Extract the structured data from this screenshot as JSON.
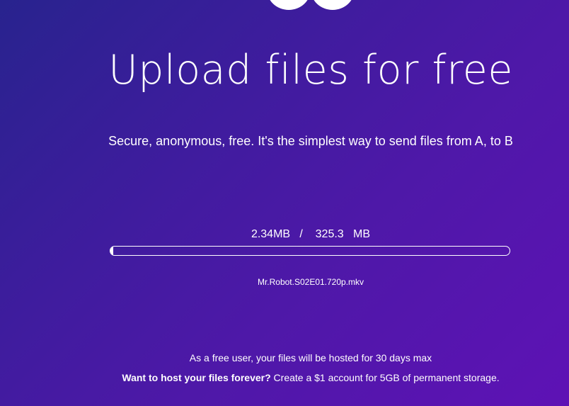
{
  "colors": {
    "background_start": "#28238e",
    "background_end": "#5e12b5",
    "text": "#ffffff"
  },
  "logo": {
    "icon": "logo-icon"
  },
  "hero": {
    "title": "Upload files for free",
    "subtitle": "Secure, anonymous, free. It's the simplest way to send files from A, to B"
  },
  "upload": {
    "uploaded": "2.34MB",
    "separator": "/",
    "total_value": "325.3",
    "total_unit": "MB",
    "progress": 0.0072,
    "filename": "Mr.Robot.S02E01.720p.mkv"
  },
  "footer": {
    "note": "As a free user, your files will be hosted for 30 days max",
    "cta_strong": "Want to host your files forever?",
    "cta_rest": "Create a $1 account for 5GB of permanent storage."
  }
}
